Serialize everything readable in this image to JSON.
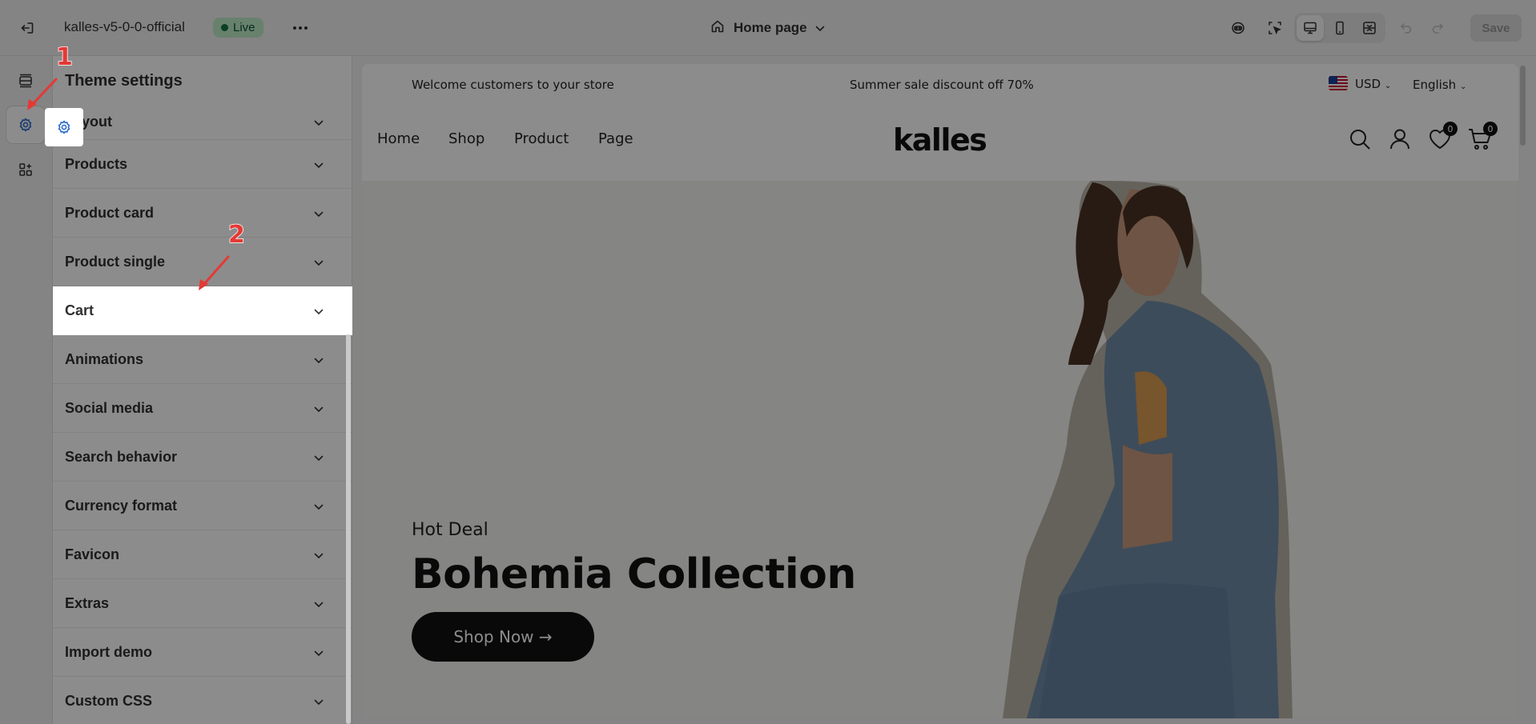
{
  "topbar": {
    "store_name": "kalles-v5-0-0-official",
    "status_badge": "Live",
    "page_selector": "Home page",
    "save_label": "Save"
  },
  "panel": {
    "title": "Theme settings",
    "items": [
      {
        "label": "Layout"
      },
      {
        "label": "Products"
      },
      {
        "label": "Product card"
      },
      {
        "label": "Product single"
      },
      {
        "label": "Cart"
      },
      {
        "label": "Animations"
      },
      {
        "label": "Social media"
      },
      {
        "label": "Search behavior"
      },
      {
        "label": "Currency format"
      },
      {
        "label": "Favicon"
      },
      {
        "label": "Extras"
      },
      {
        "label": "Import demo"
      },
      {
        "label": "Custom CSS"
      }
    ]
  },
  "preview": {
    "announcement_left": "Welcome customers to your store",
    "announcement_center": "Summer sale discount off 70%",
    "currency": "USD",
    "language": "English",
    "nav_links": [
      "Home",
      "Shop",
      "Product",
      "Page"
    ],
    "logo": "kalles",
    "wishlist_count": "0",
    "cart_count": "0",
    "hero_subtitle": "Hot Deal",
    "hero_title": "Bohemia Collection",
    "hero_button": "Shop Now →"
  },
  "annotations": {
    "marker_1": "1",
    "marker_2": "2"
  },
  "colors": {
    "live_badge_bg": "#bdebc7",
    "live_badge_text": "#0c5132",
    "annotation_red": "#e53935",
    "hero_button_bg": "#111111",
    "hero_background": "#f3f2ef",
    "dim_overlay": "rgba(0,0,0,0.45)"
  },
  "icons": {
    "exit": "exit-icon",
    "more": "more-horizontal-icon",
    "home": "home-icon",
    "chevron": "chevron-down-icon",
    "rail_sections": "sections-icon",
    "rail_settings": "gear-icon",
    "rail_apps": "apps-icon",
    "tool_ai": "sidekick-icon",
    "tool_inspect": "inspector-icon",
    "device_desktop": "desktop-icon",
    "device_mobile": "mobile-icon",
    "device_fullwidth": "fullscreen-icon",
    "undo": "undo-icon",
    "redo": "redo-icon",
    "search": "search-icon",
    "account": "user-icon",
    "wishlist": "heart-icon",
    "cart": "cart-icon"
  }
}
